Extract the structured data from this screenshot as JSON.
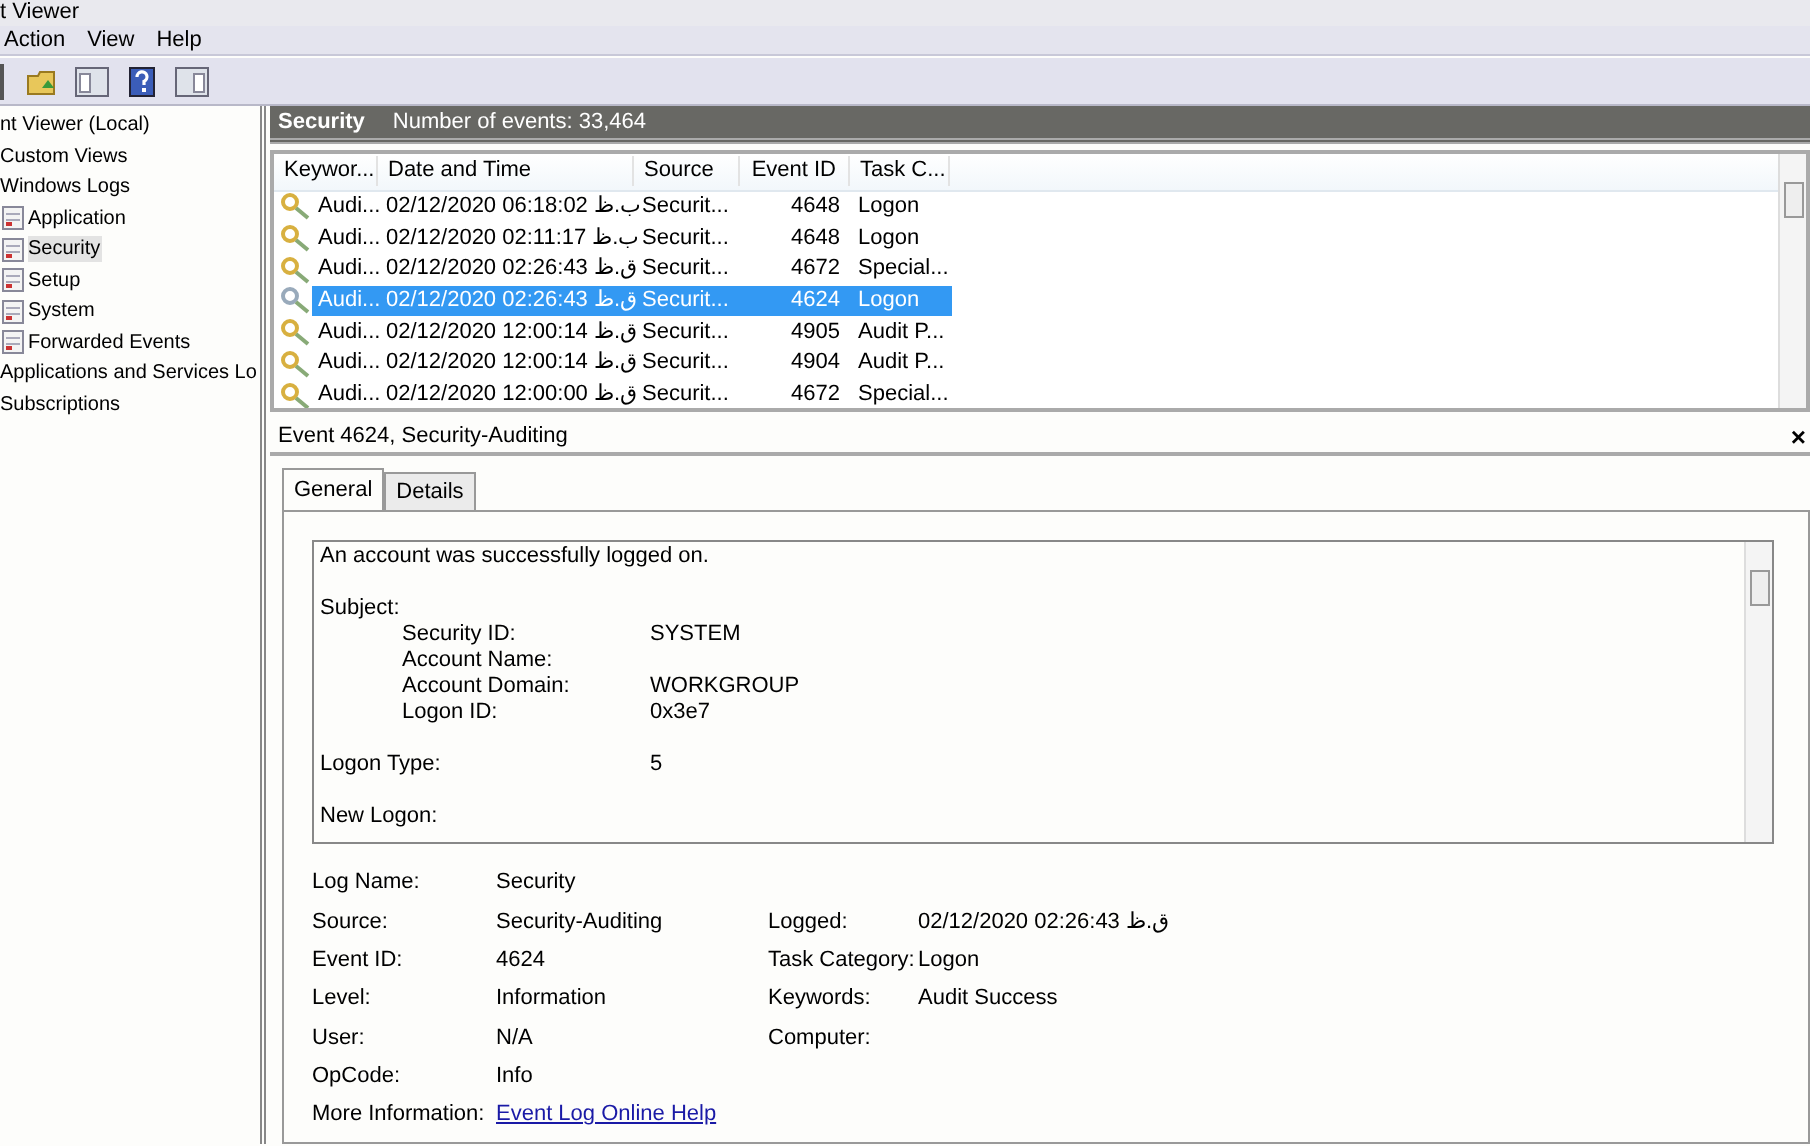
{
  "window": {
    "title": "t Viewer"
  },
  "menu": [
    {
      "label": "Action"
    },
    {
      "label": "View"
    },
    {
      "label": "Help"
    }
  ],
  "tree": [
    {
      "label": "nt Viewer (Local)",
      "selected": false
    },
    {
      "label": "Custom Views",
      "selected": false
    },
    {
      "label": "Windows Logs",
      "selected": false,
      "children": [
        {
          "label": "Application",
          "selected": false
        },
        {
          "label": "Security",
          "selected": true
        },
        {
          "label": "Setup",
          "selected": false
        },
        {
          "label": "System",
          "selected": false
        },
        {
          "label": "Forwarded Events",
          "selected": false
        }
      ]
    },
    {
      "label": "Applications and Services Lo",
      "selected": false
    },
    {
      "label": "Subscriptions",
      "selected": false
    }
  ],
  "log_header": {
    "title": "Security",
    "count": "Number of events: 33,464"
  },
  "events": {
    "columns": [
      "Keywor...",
      "Date and Time",
      "Source",
      "Event ID",
      "Task C..."
    ],
    "rows": [
      {
        "selected": false,
        "cells": [
          "Audi...",
          "02/12/2020 06:18:02 ب.ظ",
          "Securit...",
          "4648",
          "Logon"
        ]
      },
      {
        "selected": false,
        "cells": [
          "Audi...",
          "02/12/2020 02:11:17 ب.ظ",
          "Securit...",
          "4648",
          "Logon"
        ]
      },
      {
        "selected": false,
        "cells": [
          "Audi...",
          "02/12/2020 02:26:43 ق.ظ",
          "Securit...",
          "4672",
          "Special..."
        ]
      },
      {
        "selected": true,
        "cells": [
          "Audi...",
          "02/12/2020 02:26:43 ق.ظ",
          "Securit...",
          "4624",
          "Logon"
        ]
      },
      {
        "selected": false,
        "cells": [
          "Audi...",
          "02/12/2020 12:00:14 ق.ظ",
          "Securit...",
          "4905",
          "Audit P..."
        ]
      },
      {
        "selected": false,
        "cells": [
          "Audi...",
          "02/12/2020 12:00:14 ق.ظ",
          "Securit...",
          "4904",
          "Audit P..."
        ]
      },
      {
        "selected": false,
        "cells": [
          "Audi...",
          "02/12/2020 12:00:00 ق.ظ",
          "Securit...",
          "4672",
          "Special..."
        ]
      }
    ]
  },
  "detail": {
    "title": "Event 4624, Security-Auditing",
    "close": "×",
    "tabs": [
      {
        "label": "General",
        "selected": true
      },
      {
        "label": "Details",
        "selected": false
      }
    ],
    "description": [
      {
        "kind": "line",
        "text": "An account was successfully logged on."
      },
      {
        "kind": "line",
        "text": "Subject:"
      },
      {
        "kind": "field",
        "label": "Security ID:",
        "value": "SYSTEM"
      },
      {
        "kind": "field",
        "label": "Account Name:"
      },
      {
        "kind": "field",
        "label": "Account Domain:",
        "value": "WORKGROUP"
      },
      {
        "kind": "field",
        "label": "Logon ID:",
        "value": "0x3e7"
      },
      {
        "kind": "pair",
        "label": "Logon Type:",
        "value": "5"
      },
      {
        "kind": "line",
        "text": "New Logon:"
      }
    ],
    "properties": [
      {
        "left": {
          "label": "Log Name:",
          "value": "Security"
        }
      },
      {
        "left": {
          "label": "Source:",
          "value": "Security-Auditing"
        },
        "right": {
          "label": "Logged:",
          "value": "02/12/2020 02:26:43 ق.ظ"
        }
      },
      {
        "left": {
          "label": "Event ID:",
          "value": "4624"
        },
        "right": {
          "label": "Task Category:",
          "value": "Logon"
        }
      },
      {
        "left": {
          "label": "Level:",
          "value": "Information"
        },
        "right": {
          "label": "Keywords:",
          "value": "Audit Success"
        }
      },
      {
        "left": {
          "label": "User:",
          "value": "N/A"
        },
        "right": {
          "label": "Computer:"
        }
      },
      {
        "left": {
          "label": "OpCode:",
          "value": "Info"
        }
      },
      {
        "left": {
          "label": "More Information:",
          "value": "Event Log Online Help",
          "kind": "link"
        }
      }
    ]
  }
}
